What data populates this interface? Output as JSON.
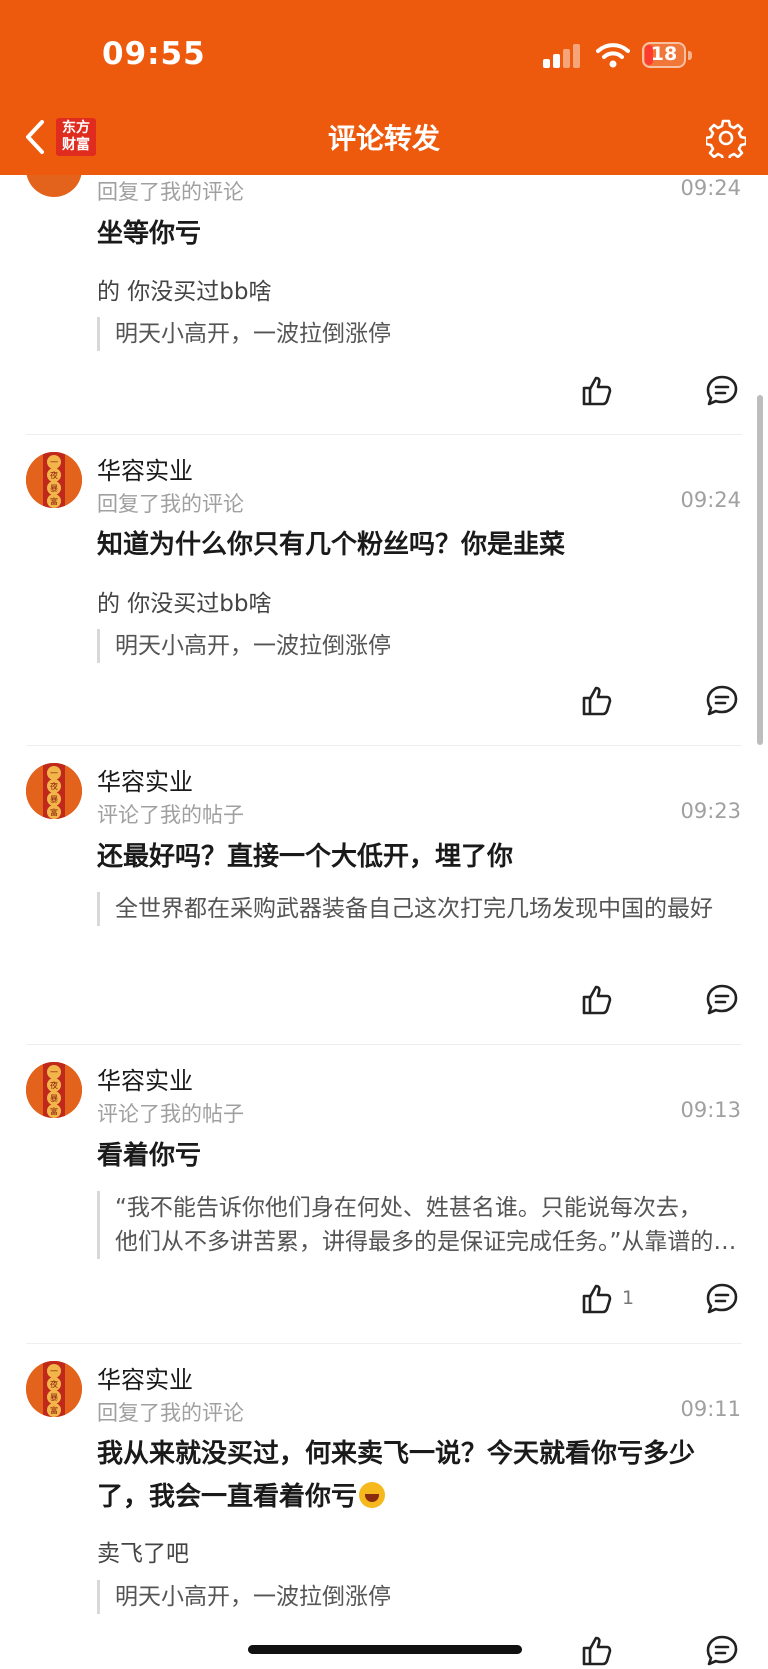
{
  "status_bar": {
    "time": "09:55",
    "battery": "18"
  },
  "header": {
    "title": "评论转发",
    "logo_line1": "东方",
    "logo_line2": "财富"
  },
  "avatar_text": [
    "一",
    "夜",
    "暴",
    "富"
  ],
  "items": [
    {
      "name": "",
      "action": "回复了我的评论",
      "time": "09:24",
      "comment": "坐等你亏",
      "sub": "的 你没买过bb啥",
      "quote": "明天小高开，一波拉倒涨停",
      "likes": ""
    },
    {
      "name": "华容实业",
      "action": "回复了我的评论",
      "time": "09:24",
      "comment": "知道为什么你只有几个粉丝吗？你是韭菜",
      "sub": "的 你没买过bb啥",
      "quote": "明天小高开，一波拉倒涨停",
      "likes": ""
    },
    {
      "name": "华容实业",
      "action": "评论了我的帖子",
      "time": "09:23",
      "comment": "还最好吗？直接一个大低开，埋了你",
      "sub": "",
      "quote": "全世界都在采购武器装备自己这次打完几场发现中国的最好",
      "likes": ""
    },
    {
      "name": "华容实业",
      "action": "评论了我的帖子",
      "time": "09:13",
      "comment": "看着你亏",
      "sub": "",
      "quote_line1": "“我不能告诉你他们身在何处、姓甚名谁。只能说每次去，",
      "quote_line2": "他们从不多讲苦累，讲得最多的是保证完成任务。”从靠谱的渠道获悉",
      "likes": "1"
    },
    {
      "name": "华容实业",
      "action": "回复了我的评论",
      "time": "09:11",
      "comment": "我从来就没买过，何来卖飞一说？今天就看你亏多少了，我会一直看着你亏",
      "sub": "卖飞了吧",
      "quote": "明天小高开，一波拉倒涨停",
      "likes": ""
    }
  ]
}
